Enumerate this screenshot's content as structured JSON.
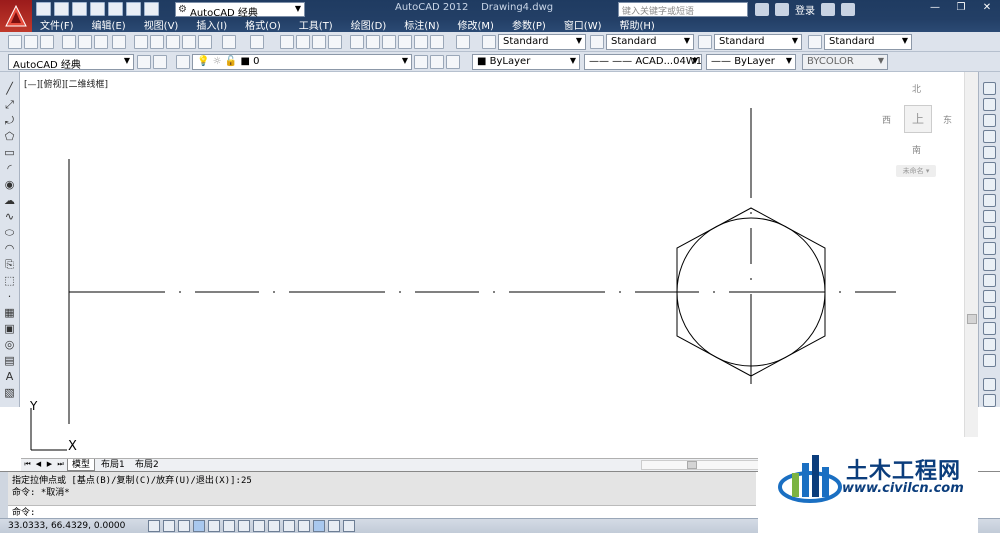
{
  "titlebar": {
    "workspace": "AutoCAD 经典",
    "app_name": "AutoCAD 2012",
    "file_name": "Drawing4.dwg",
    "search_placeholder": "键入关键字或短语",
    "login_label": "登录"
  },
  "menu": [
    "文件(F)",
    "编辑(E)",
    "视图(V)",
    "插入(I)",
    "格式(O)",
    "工具(T)",
    "绘图(D)",
    "标注(N)",
    "修改(M)",
    "参数(P)",
    "窗口(W)",
    "帮助(H)"
  ],
  "toolbar": {
    "text_style": "Standard",
    "dim_style": "Standard",
    "table_style": "Standard",
    "multileader_style": "Standard",
    "workspace2": "AutoCAD 经典",
    "layer": "0",
    "color": "ByLayer",
    "linetype": "ACAD...04W100",
    "lineweight": "ByLayer",
    "plot_style": "BYCOLOR"
  },
  "viewport": {
    "label": "[—][俯视][二维线框]",
    "viewcube": {
      "north": "北",
      "south": "南",
      "east": "东",
      "west": "西",
      "top": "上",
      "ucs": "未命名"
    },
    "ucs_x": "X",
    "ucs_y": "Y"
  },
  "tabs": [
    "模型",
    "布局1",
    "布局2"
  ],
  "command": {
    "history": [
      "指定拉伸点或 [基点(B)/复制(C)/放弃(U)/退出(X)]:25",
      "命令: *取消*"
    ],
    "prompt": "命令:"
  },
  "status": {
    "coords": "33.0333,  66.4329, 0.0000"
  },
  "watermark": {
    "title": "土木工程网",
    "url": "www.civilcn.com"
  },
  "colors": {
    "titlebar": "#1f3b61",
    "menu_text": "#ffffff",
    "watermark": "#0b3d7c"
  }
}
